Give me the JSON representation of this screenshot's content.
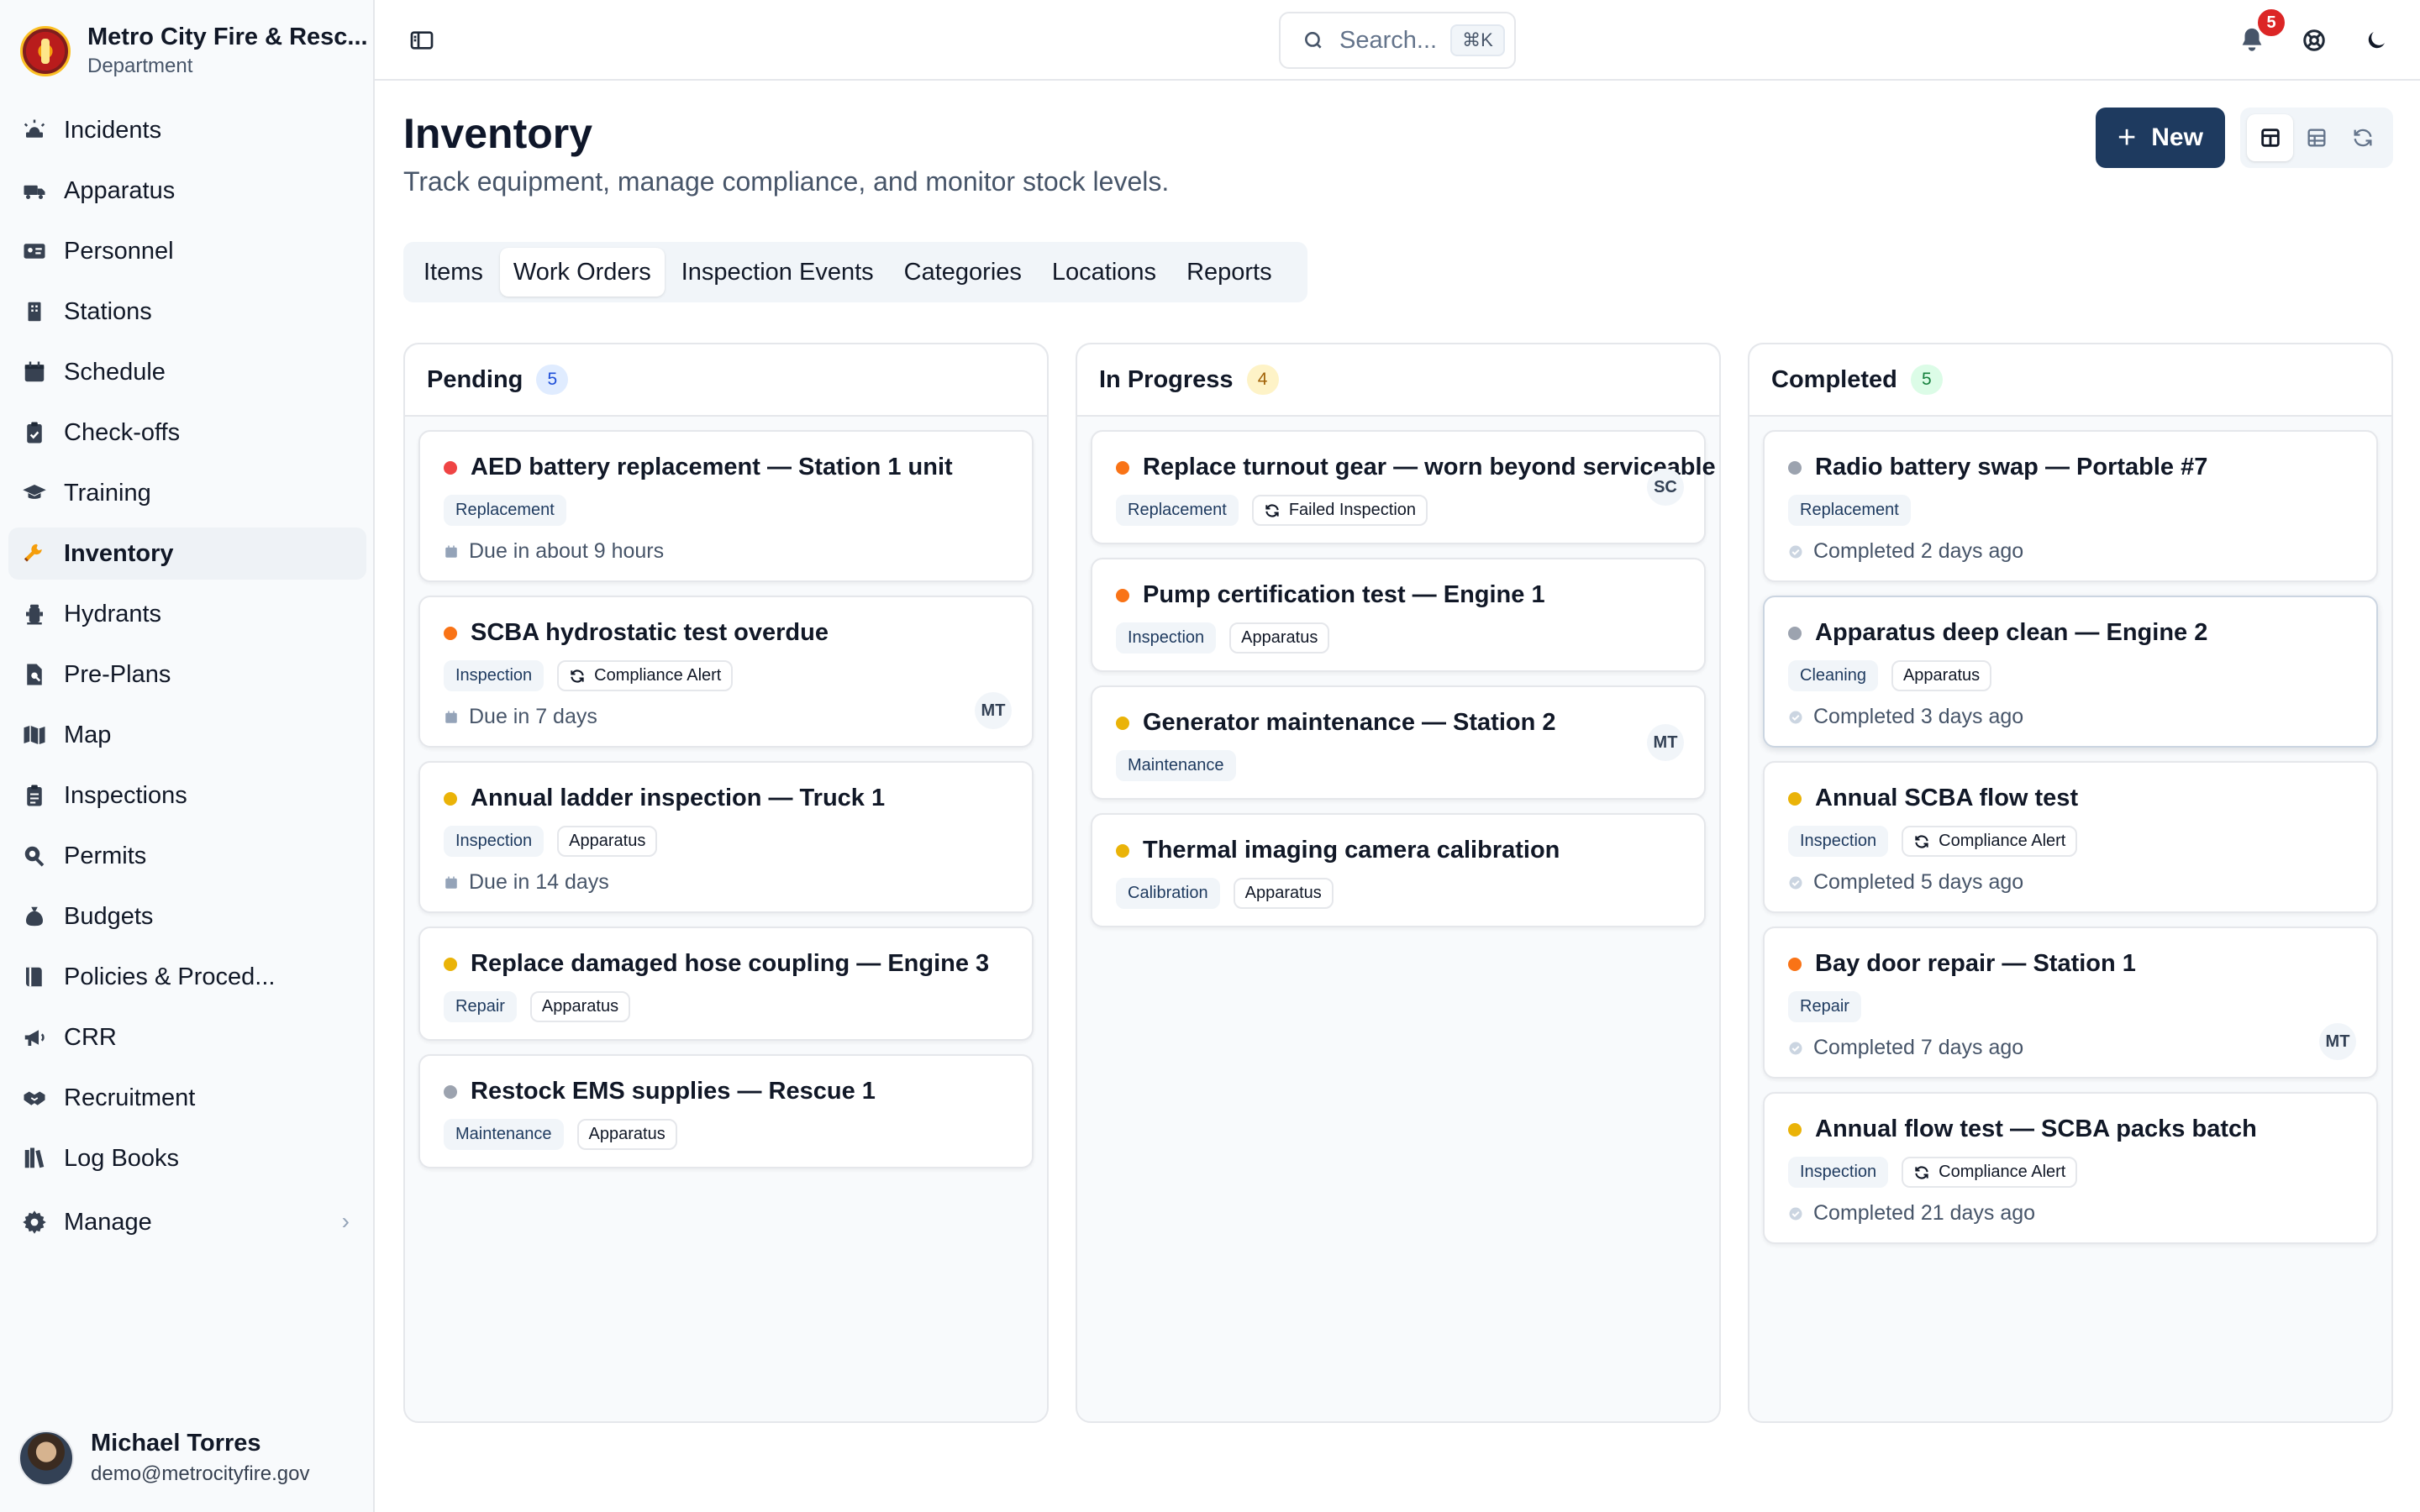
{
  "org": {
    "name": "Metro City Fire & Resc...",
    "subtitle": "Department"
  },
  "nav": {
    "items": [
      {
        "label": "Incidents",
        "icon": "siren-icon"
      },
      {
        "label": "Apparatus",
        "icon": "truck-icon"
      },
      {
        "label": "Personnel",
        "icon": "id-card-icon"
      },
      {
        "label": "Stations",
        "icon": "building-icon"
      },
      {
        "label": "Schedule",
        "icon": "calendar-icon"
      },
      {
        "label": "Check-offs",
        "icon": "clipboard-check-icon"
      },
      {
        "label": "Training",
        "icon": "graduation-cap-icon"
      },
      {
        "label": "Inventory",
        "icon": "wrench-icon",
        "active": true
      },
      {
        "label": "Hydrants",
        "icon": "hydrant-icon"
      },
      {
        "label": "Pre-Plans",
        "icon": "file-search-icon"
      },
      {
        "label": "Map",
        "icon": "map-icon"
      },
      {
        "label": "Inspections",
        "icon": "clipboard-list-icon"
      },
      {
        "label": "Permits",
        "icon": "permit-icon"
      },
      {
        "label": "Budgets",
        "icon": "money-bag-icon"
      },
      {
        "label": "Policies & Proced...",
        "icon": "book-icon"
      },
      {
        "label": "CRR",
        "icon": "megaphone-icon"
      },
      {
        "label": "Recruitment",
        "icon": "handshake-icon"
      },
      {
        "label": "Log Books",
        "icon": "books-icon"
      }
    ],
    "manage": {
      "label": "Manage",
      "icon": "gear-icon"
    }
  },
  "user": {
    "name": "Michael Torres",
    "email": "demo@metrocityfire.gov"
  },
  "topbar": {
    "search_placeholder": "Search...",
    "search_shortcut": "⌘K",
    "notification_count": "5"
  },
  "page": {
    "title": "Inventory",
    "subtitle": "Track equipment, manage compliance, and monitor stock levels.",
    "new_button": "New"
  },
  "tabs": [
    {
      "label": "Items"
    },
    {
      "label": "Work Orders",
      "active": true
    },
    {
      "label": "Inspection Events"
    },
    {
      "label": "Categories"
    },
    {
      "label": "Locations"
    },
    {
      "label": "Reports"
    }
  ],
  "colors": {
    "brand": "#1e3a5f",
    "priority_critical": "#ef4444",
    "priority_high": "#f97316",
    "priority_medium": "#eab308",
    "priority_low": "#9ca3af"
  },
  "columns": [
    {
      "title": "Pending",
      "count": "5",
      "badge_bg": "#e0ecff",
      "badge_fg": "#1d4ed8",
      "cards": [
        {
          "title": "AED battery replacement — Station 1 unit",
          "priority": "#ef4444",
          "tags": [
            {
              "label": "Replacement",
              "primary": true
            }
          ],
          "meta": "Due in about 9 hours",
          "meta_icon": "calendar-icon"
        },
        {
          "title": "SCBA hydrostatic test overdue",
          "priority": "#f97316",
          "tags": [
            {
              "label": "Inspection",
              "primary": true
            },
            {
              "label": "Compliance Alert",
              "icon": true
            }
          ],
          "meta": "Due in 7 days",
          "meta_icon": "calendar-icon",
          "assignee": "MT"
        },
        {
          "title": "Annual ladder inspection — Truck 1",
          "priority": "#eab308",
          "tags": [
            {
              "label": "Inspection",
              "primary": true
            },
            {
              "label": "Apparatus"
            }
          ],
          "meta": "Due in 14 days",
          "meta_icon": "calendar-icon"
        },
        {
          "title": "Replace damaged hose coupling — Engine 3",
          "priority": "#eab308",
          "tags": [
            {
              "label": "Repair",
              "primary": true
            },
            {
              "label": "Apparatus"
            }
          ]
        },
        {
          "title": "Restock EMS supplies — Rescue 1",
          "priority": "#9ca3af",
          "tags": [
            {
              "label": "Maintenance",
              "primary": true
            },
            {
              "label": "Apparatus"
            }
          ]
        }
      ]
    },
    {
      "title": "In Progress",
      "count": "4",
      "badge_bg": "#fef3c7",
      "badge_fg": "#a16207",
      "cards": [
        {
          "title": "Replace turnout gear — worn beyond serviceable",
          "priority": "#f97316",
          "tags": [
            {
              "label": "Replacement",
              "primary": true
            },
            {
              "label": "Failed Inspection",
              "icon": true
            }
          ],
          "assignee": "SC"
        },
        {
          "title": "Pump certification test — Engine 1",
          "priority": "#f97316",
          "tags": [
            {
              "label": "Inspection",
              "primary": true
            },
            {
              "label": "Apparatus"
            }
          ]
        },
        {
          "title": "Generator maintenance — Station 2",
          "priority": "#eab308",
          "tags": [
            {
              "label": "Maintenance",
              "primary": true
            }
          ],
          "assignee": "MT"
        },
        {
          "title": "Thermal imaging camera calibration",
          "priority": "#eab308",
          "tags": [
            {
              "label": "Calibration",
              "primary": true
            },
            {
              "label": "Apparatus"
            }
          ]
        }
      ]
    },
    {
      "title": "Completed",
      "count": "5",
      "badge_bg": "#dcfce7",
      "badge_fg": "#15803d",
      "cards": [
        {
          "title": "Radio battery swap — Portable #7",
          "priority": "#9ca3af",
          "tags": [
            {
              "label": "Replacement",
              "primary": true
            }
          ],
          "meta": "Completed 2 days ago",
          "meta_icon": "check-circle-icon"
        },
        {
          "title": "Apparatus deep clean — Engine 2",
          "priority": "#9ca3af",
          "tags": [
            {
              "label": "Cleaning",
              "primary": true
            },
            {
              "label": "Apparatus"
            }
          ],
          "meta": "Completed 3 days ago",
          "meta_icon": "check-circle-icon",
          "highlight": true
        },
        {
          "title": "Annual SCBA flow test",
          "priority": "#eab308",
          "tags": [
            {
              "label": "Inspection",
              "primary": true
            },
            {
              "label": "Compliance Alert",
              "icon": true
            }
          ],
          "meta": "Completed 5 days ago",
          "meta_icon": "check-circle-icon"
        },
        {
          "title": "Bay door repair — Station 1",
          "priority": "#f97316",
          "tags": [
            {
              "label": "Repair",
              "primary": true
            }
          ],
          "meta": "Completed 7 days ago",
          "meta_icon": "check-circle-icon",
          "assignee": "MT"
        },
        {
          "title": "Annual flow test — SCBA packs batch",
          "priority": "#eab308",
          "tags": [
            {
              "label": "Inspection",
              "primary": true
            },
            {
              "label": "Compliance Alert",
              "icon": true
            }
          ],
          "meta": "Completed 21 days ago",
          "meta_icon": "check-circle-icon"
        }
      ]
    }
  ]
}
